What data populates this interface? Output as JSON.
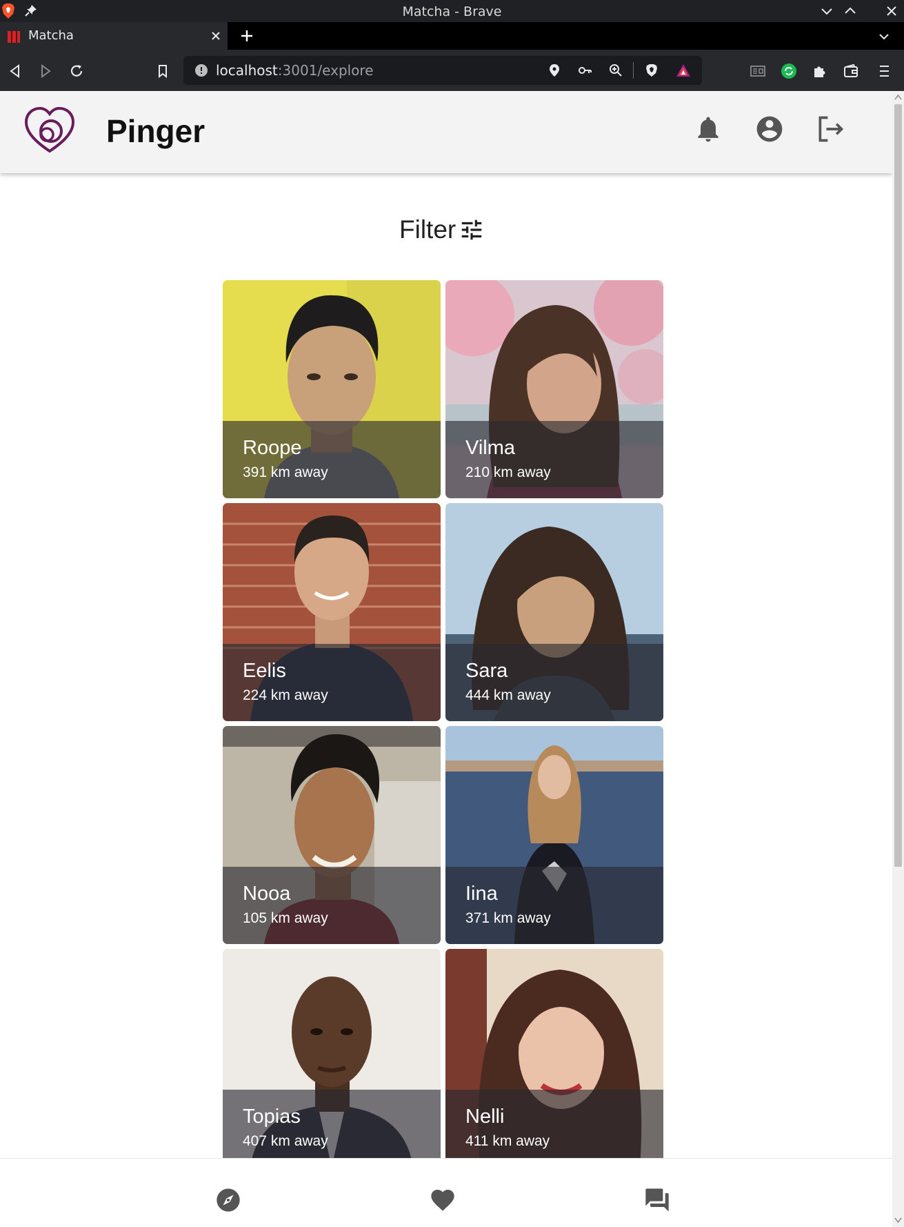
{
  "window": {
    "title": "Matcha - Brave"
  },
  "tab": {
    "title": "Matcha"
  },
  "address": {
    "host": "localhost",
    "path": ":3001/explore"
  },
  "app": {
    "brand": "Pinger",
    "filter_label": "Filter"
  },
  "colors": {
    "brand_purple": "#6a1b5c",
    "icon_grey": "#555555",
    "chrome_dark": "#28292c"
  },
  "icons": {
    "header": [
      "bell-icon",
      "account-circle-icon",
      "logout-icon"
    ],
    "bottom_nav": [
      "explore-compass-icon",
      "heart-icon",
      "chat-icon"
    ],
    "filter": "tune-icon"
  },
  "profiles": [
    {
      "name": "Roope",
      "distance": "391 km away"
    },
    {
      "name": "Vilma",
      "distance": "210 km away"
    },
    {
      "name": "Eelis",
      "distance": "224 km away"
    },
    {
      "name": "Sara",
      "distance": "444 km away"
    },
    {
      "name": "Nooa",
      "distance": "105 km away"
    },
    {
      "name": "Iina",
      "distance": "371 km away"
    },
    {
      "name": "Topias",
      "distance": "407 km away"
    },
    {
      "name": "Nelli",
      "distance": "411 km away"
    }
  ]
}
